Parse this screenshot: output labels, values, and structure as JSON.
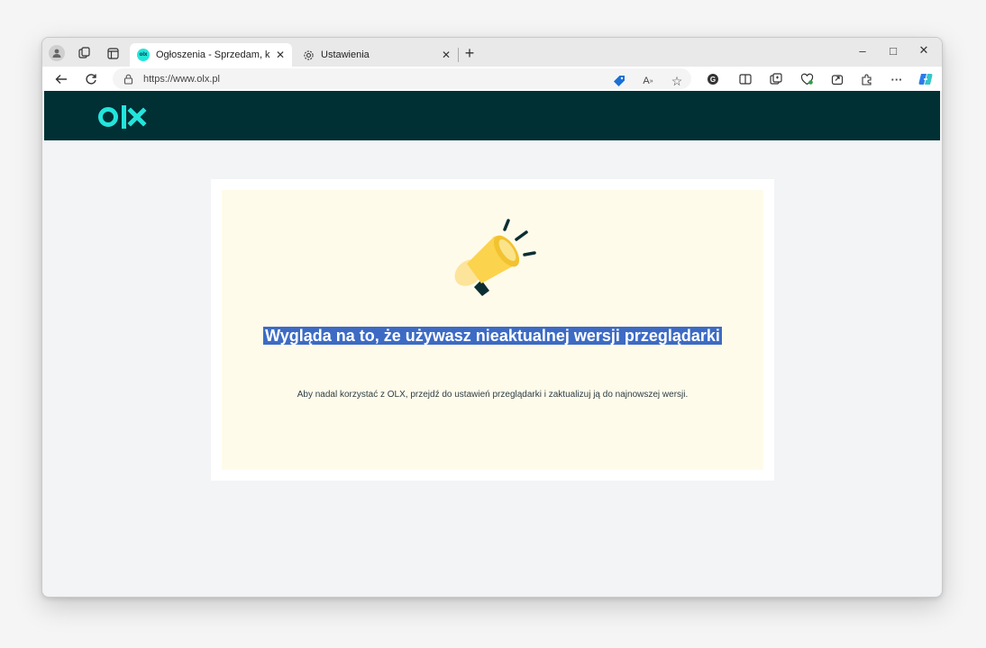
{
  "browser": {
    "tabs": [
      {
        "title": "Ogłoszenia - Sprzedam, kupię na",
        "favicon_text": "olx",
        "active": true
      },
      {
        "title": "Ustawienia",
        "active": false
      }
    ],
    "new_tab_symbol": "+",
    "address": {
      "url": "https://www.olx.pl"
    },
    "window_controls": {
      "minimize": "–",
      "maximize": "□",
      "close": "✕"
    },
    "more_symbol": "···"
  },
  "page": {
    "logo_text": "olx",
    "heading": "Wygląda na to, że używasz nieaktualnej wersji przeglądarki",
    "message": "Aby nadal korzystać z OLX, przejdź do ustawień przeglądarki i zaktualizuj ją do najnowszej wersji.",
    "colors": {
      "header_bg": "#002f34",
      "logo_accent": "#23e5db",
      "card_bg": "#fffbeb",
      "selection": "#3d6bc4"
    }
  }
}
